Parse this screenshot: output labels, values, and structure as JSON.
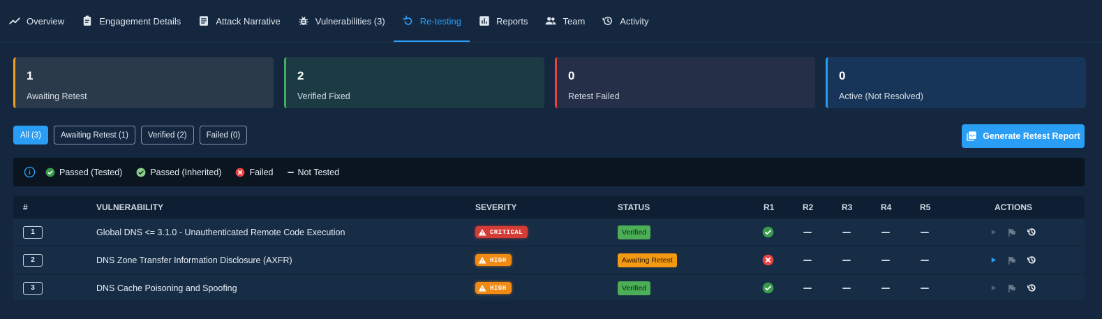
{
  "tabs": [
    {
      "label": "Overview",
      "icon": "trend-icon"
    },
    {
      "label": "Engagement Details",
      "icon": "clipboard-icon"
    },
    {
      "label": "Attack Narrative",
      "icon": "document-icon"
    },
    {
      "label": "Vulnerabilities (3)",
      "icon": "bug-icon"
    },
    {
      "label": "Re-testing",
      "icon": "refresh-icon",
      "active": true
    },
    {
      "label": "Reports",
      "icon": "bar-chart-icon"
    },
    {
      "label": "Team",
      "icon": "people-icon"
    },
    {
      "label": "Activity",
      "icon": "history-icon"
    }
  ],
  "cards": [
    {
      "value": "1",
      "label": "Awaiting Retest"
    },
    {
      "value": "2",
      "label": "Verified Fixed"
    },
    {
      "value": "0",
      "label": "Retest Failed"
    },
    {
      "value": "0",
      "label": "Active (Not Resolved)"
    }
  ],
  "filters": [
    "All (3)",
    "Awaiting Retest (1)",
    "Verified (2)",
    "Failed (0)"
  ],
  "generate_button": "Generate Retest Report",
  "legend": [
    "Passed (Tested)",
    "Passed (Inherited)",
    "Failed",
    "Not Tested"
  ],
  "table": {
    "headers": [
      "#",
      "VULNERABILITY",
      "SEVERITY",
      "STATUS",
      "R1",
      "R2",
      "R3",
      "R4",
      "R5",
      "ACTIONS"
    ],
    "rows": [
      {
        "num": "1",
        "name": "Global DNS <= 3.1.0 - Unauthenticated Remote Code Execution",
        "severity": "CRITICAL",
        "status": "Verified",
        "r1": "passed"
      },
      {
        "num": "2",
        "name": "DNS Zone Transfer Information Disclosure (AXFR)",
        "severity": "HIGH",
        "status": "Awaiting Retest",
        "r1": "failed"
      },
      {
        "num": "3",
        "name": "DNS Cache Poisoning and Spoofing",
        "severity": "HIGH",
        "status": "Verified",
        "r1": "passed"
      }
    ]
  },
  "colors": {
    "accent": "#2a9df4",
    "critical": "#d63c36",
    "high": "#f08a14",
    "verified": "#4caf58",
    "awaiting": "#f49a12",
    "failed": "#e8423f"
  }
}
